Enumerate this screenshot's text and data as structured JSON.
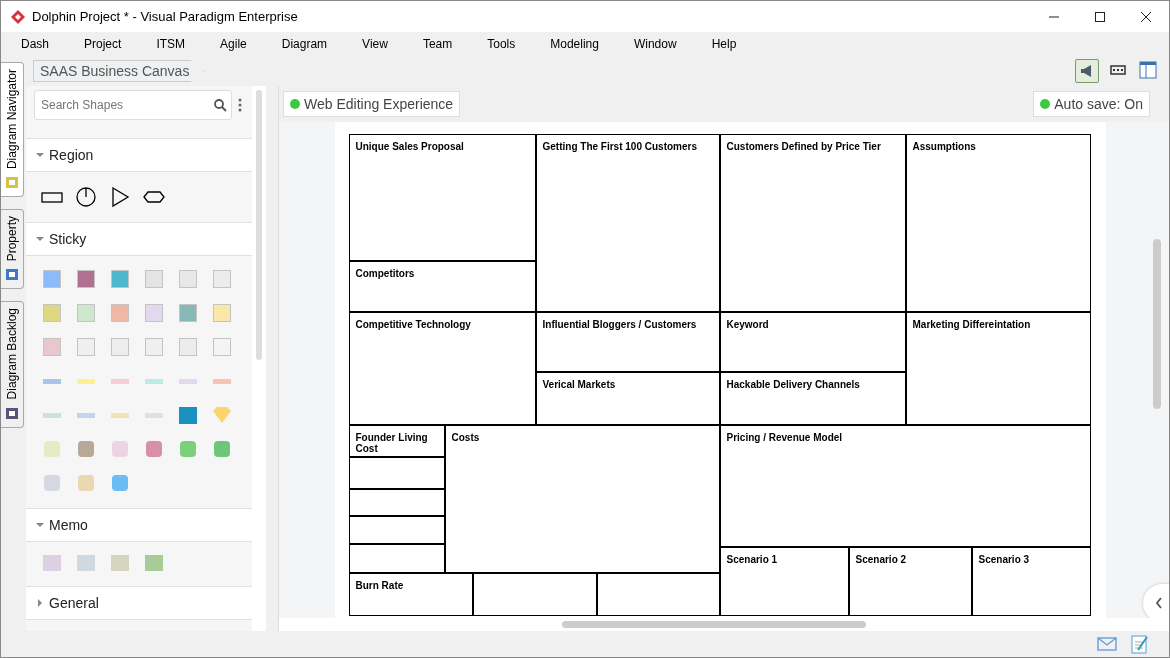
{
  "window": {
    "title": "Dolphin Project * - Visual Paradigm Enterprise"
  },
  "menu": [
    "Dash",
    "Project",
    "ITSM",
    "Agile",
    "Diagram",
    "View",
    "Team",
    "Tools",
    "Modeling",
    "Window",
    "Help"
  ],
  "side_tabs": [
    {
      "label": "Diagram Navigator",
      "selected": true
    },
    {
      "label": "Property",
      "selected": false
    },
    {
      "label": "Diagram Backlog",
      "selected": false
    }
  ],
  "breadcrumb": "SAAS Business Canvas",
  "search": {
    "placeholder": "Search Shapes"
  },
  "sections": [
    {
      "title": "Region",
      "expanded": true
    },
    {
      "title": "Sticky",
      "expanded": true
    },
    {
      "title": "Memo",
      "expanded": true
    },
    {
      "title": "General",
      "expanded": false
    }
  ],
  "web_editing": "Web Editing Experience",
  "auto_save": "Auto save: On",
  "canvas": {
    "cells": [
      "Unique Sales Proposal",
      "Competitors",
      "Getting The First 100 Customers",
      "Customers Defined by Price Tier",
      "Assumptions",
      "Competitive Technology",
      "Influential Bloggers / Customers",
      "Verical Markets",
      "Keyword",
      "Hackable Delivery Channels",
      "Marketing Differeintation",
      "Founder Living Cost",
      "Costs",
      "Pricing / Revenue Model",
      "Scenario 1",
      "Scenario 2",
      "Scenario 3",
      "Burn Rate"
    ]
  }
}
